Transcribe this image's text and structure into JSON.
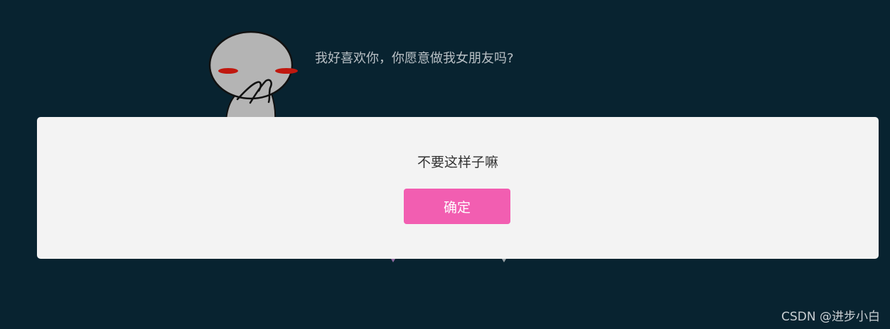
{
  "question": {
    "text": "我好喜欢你，你愿意做我女朋友吗?"
  },
  "dialog": {
    "message": "不要这样子嘛",
    "confirm_label": "确定"
  },
  "watermark": {
    "text": "CSDN @进步小白"
  },
  "colors": {
    "background": "#082330",
    "dialog_background": "#f3f3f3",
    "confirm_button": "#f25eb1",
    "blush": "#c0180f",
    "character": "#b4b4b4"
  },
  "icons": {
    "character": "shy-character-icon"
  }
}
